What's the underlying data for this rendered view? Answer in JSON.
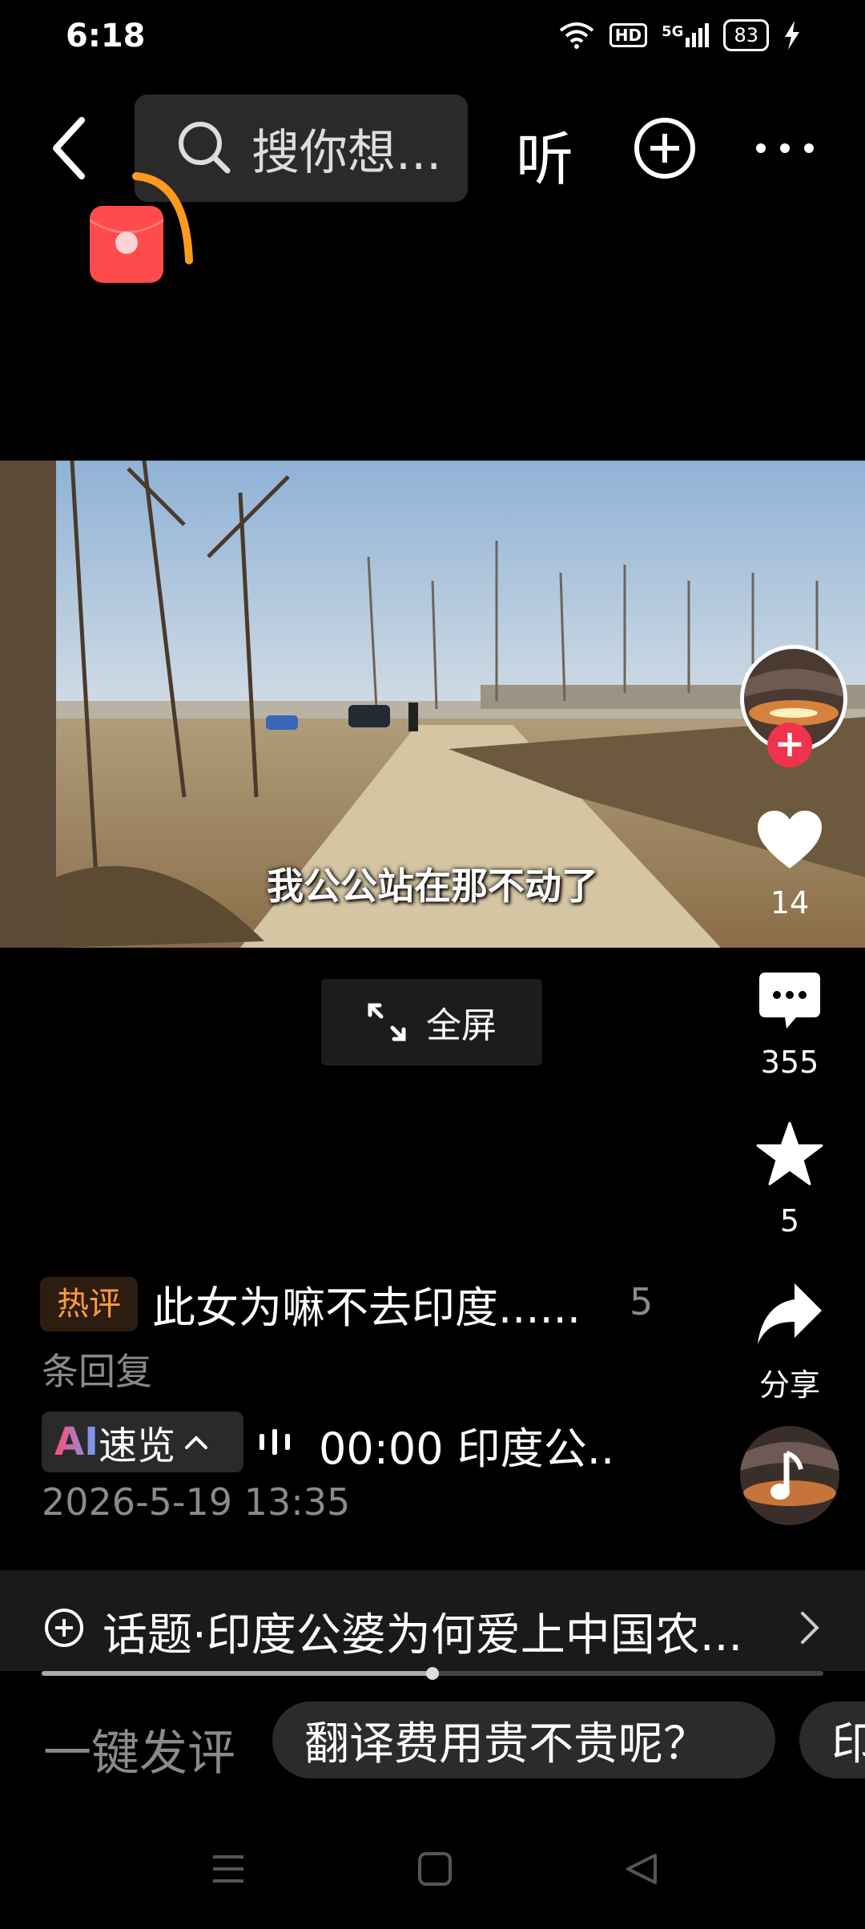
{
  "status_bar": {
    "time": "6:18",
    "hd": "HD",
    "network": "5G",
    "battery": "83"
  },
  "top_nav": {
    "search_placeholder": "搜你想...",
    "listen_label": "听"
  },
  "video": {
    "subtitle": "我公公站在那不动了"
  },
  "fullscreen_label": "全屏",
  "right_rail": {
    "like_count": "14",
    "comment_count": "355",
    "favorite_count": "5",
    "share_label": "分享"
  },
  "comment": {
    "hot_tag": "热评",
    "text": "此女为嘛不去印度......",
    "reply_count_part1": "5",
    "reply_count_part2": "条回复"
  },
  "ai_summary": {
    "ai": "AI",
    "label": "速览",
    "audio_text": "00:00 印度公.."
  },
  "post_date": "2026-5-19 13:35",
  "topic": {
    "text": "话题·印度公婆为何爱上中国农...",
    "progress": 0.5
  },
  "quick_reply": {
    "label": "一键发评",
    "chips": [
      "翻译费用贵不贵呢？",
      "印"
    ]
  },
  "colors": {
    "accent_red": "#f0334d",
    "hot_orange": "#ff9a3c",
    "redpacket": "#ff4b4b"
  }
}
